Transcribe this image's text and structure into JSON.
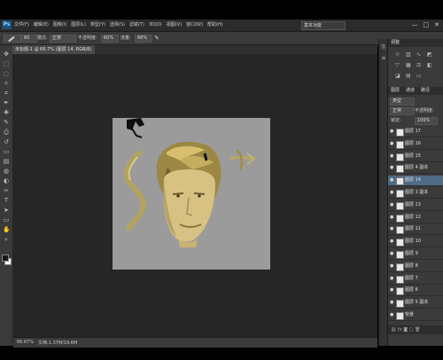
{
  "app": {
    "logo": "Ps",
    "menu": [
      "文件(F)",
      "编辑(E)",
      "图像(I)",
      "图层(L)",
      "类型(Y)",
      "选择(S)",
      "滤镜(T)",
      "3D(D)",
      "视图(V)",
      "窗口(W)",
      "帮助(H)"
    ],
    "workspace": "基本功能",
    "window_controls": [
      "—",
      "□",
      "✕"
    ]
  },
  "options_bar": {
    "brush_size": "60",
    "mode_label": "模式:",
    "mode_value": "正常",
    "opacity_label": "不透明度:",
    "opacity_value": "60%",
    "flow_label": "流量:",
    "flow_value": "66%"
  },
  "document": {
    "tab": "未标题-1 @ 66.7% (图层 14, RGB/8)"
  },
  "status": {
    "zoom": "66.67%",
    "doc_info": "文档:1.37M/19.6M"
  },
  "panels": {
    "top_title": "调整",
    "layers_tabs": [
      "图层",
      "通道",
      "路径"
    ],
    "kind_label": "类型",
    "blend_mode": "正常",
    "opacity_label": "不透明度:",
    "opacity_value": "100%",
    "lock_label": "锁定:",
    "fill_label": "填充:",
    "fill_value": "100%"
  },
  "layers": [
    {
      "name": "图层 17"
    },
    {
      "name": "图层 16"
    },
    {
      "name": "图层 15"
    },
    {
      "name": "图层 4 副本"
    },
    {
      "name": "图层 14",
      "active": true
    },
    {
      "name": "图层 3 副本"
    },
    {
      "name": "图层 13"
    },
    {
      "name": "图层 12"
    },
    {
      "name": "图层 11"
    },
    {
      "name": "图层 10"
    },
    {
      "name": "图层 9"
    },
    {
      "name": "图层 8"
    },
    {
      "name": "图层 7"
    },
    {
      "name": "图层 6"
    },
    {
      "name": "图层 5 副本"
    },
    {
      "name": "背景"
    }
  ],
  "colors": {
    "foreground": "#1a1a1a",
    "background": "#ffffff",
    "canvas": "#9b9b9b",
    "workspace": "#262626",
    "active_layer": "#4f6a85"
  }
}
